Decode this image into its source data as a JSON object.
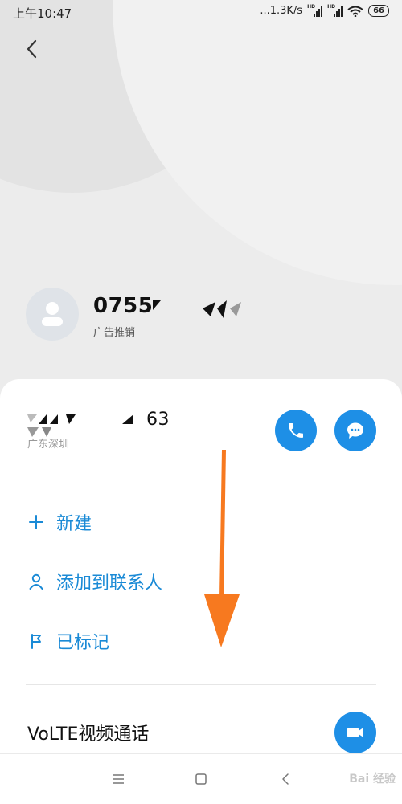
{
  "status_bar": {
    "time": "上午10:47",
    "network_speed": "...1.3K/s",
    "sim1_label": "HD",
    "sim2_label": "HD",
    "battery": "66"
  },
  "header": {
    "number": "0755",
    "tag": "广告推销"
  },
  "card": {
    "number_partial": "63",
    "location": "广东深圳",
    "actions": [
      {
        "label": "新建",
        "icon": "plus-icon"
      },
      {
        "label": "添加到联系人",
        "icon": "person-icon"
      },
      {
        "label": "已标记",
        "icon": "flag-icon"
      }
    ],
    "volte_label": "VoLTE视频通话"
  },
  "nav": {
    "watermark": "Bai 经验"
  },
  "colors": {
    "accent": "#1e8fe6",
    "accent_text": "#1a8ad6",
    "arrow": "#f7791f"
  }
}
